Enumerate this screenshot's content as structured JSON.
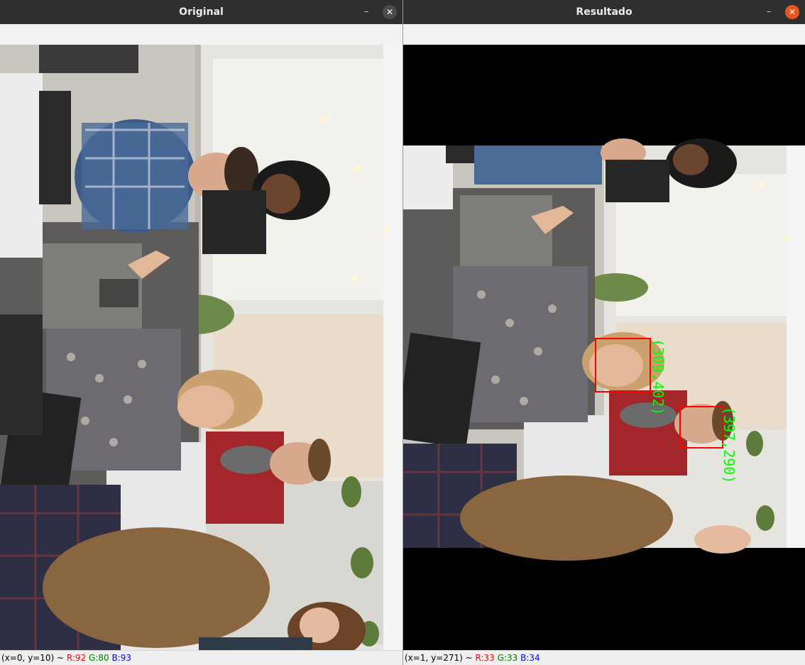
{
  "windows": {
    "original": {
      "title": "Original",
      "minimize_glyph": "–",
      "close_glyph": "✕",
      "close_color": "#4a4a4a",
      "status": {
        "coords": "(x=0, y=10) ~ ",
        "r": "R:92",
        "g": "G:80",
        "b": "B:93"
      }
    },
    "result": {
      "title": "Resultado",
      "minimize_glyph": "–",
      "close_glyph": "✕",
      "close_color": "#e95420",
      "status": {
        "coords": "(x=1, y=271) ~ ",
        "r": "R:33",
        "g": "G:33",
        "b": "B:34"
      },
      "detections": [
        {
          "label": "(309,402)",
          "color": "#ff0000",
          "text_color": "#00ff00"
        },
        {
          "label": "(397,290)",
          "color": "#ff0000",
          "text_color": "#00ff00"
        }
      ]
    }
  },
  "colors": {
    "titlebar": "#2f2f2f",
    "letterbox": "#000000",
    "status_r": "#ff0000",
    "status_g": "#008000",
    "status_b": "#0000ff"
  }
}
